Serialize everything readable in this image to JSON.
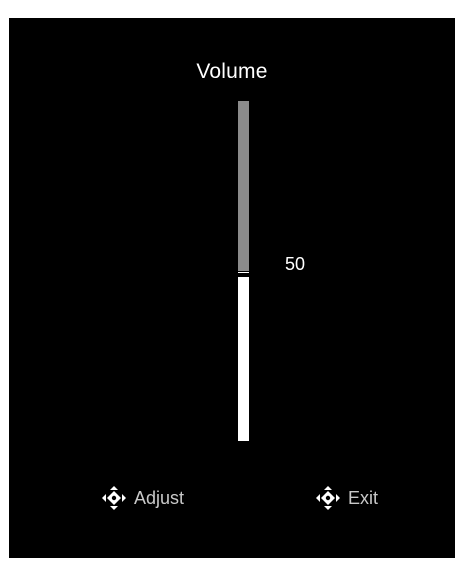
{
  "osd": {
    "title": "Volume",
    "value": "50",
    "level_percent": 50,
    "colors": {
      "background": "#000000",
      "track_upper": "#8b8b8b",
      "track_lower": "#ffffff",
      "text": "#ffffff",
      "hint_text": "#c9c9c9"
    }
  },
  "hints": [
    {
      "label": "Adjust",
      "icon": "dpad-icon"
    },
    {
      "label": "Exit",
      "icon": "dpad-icon"
    }
  ]
}
